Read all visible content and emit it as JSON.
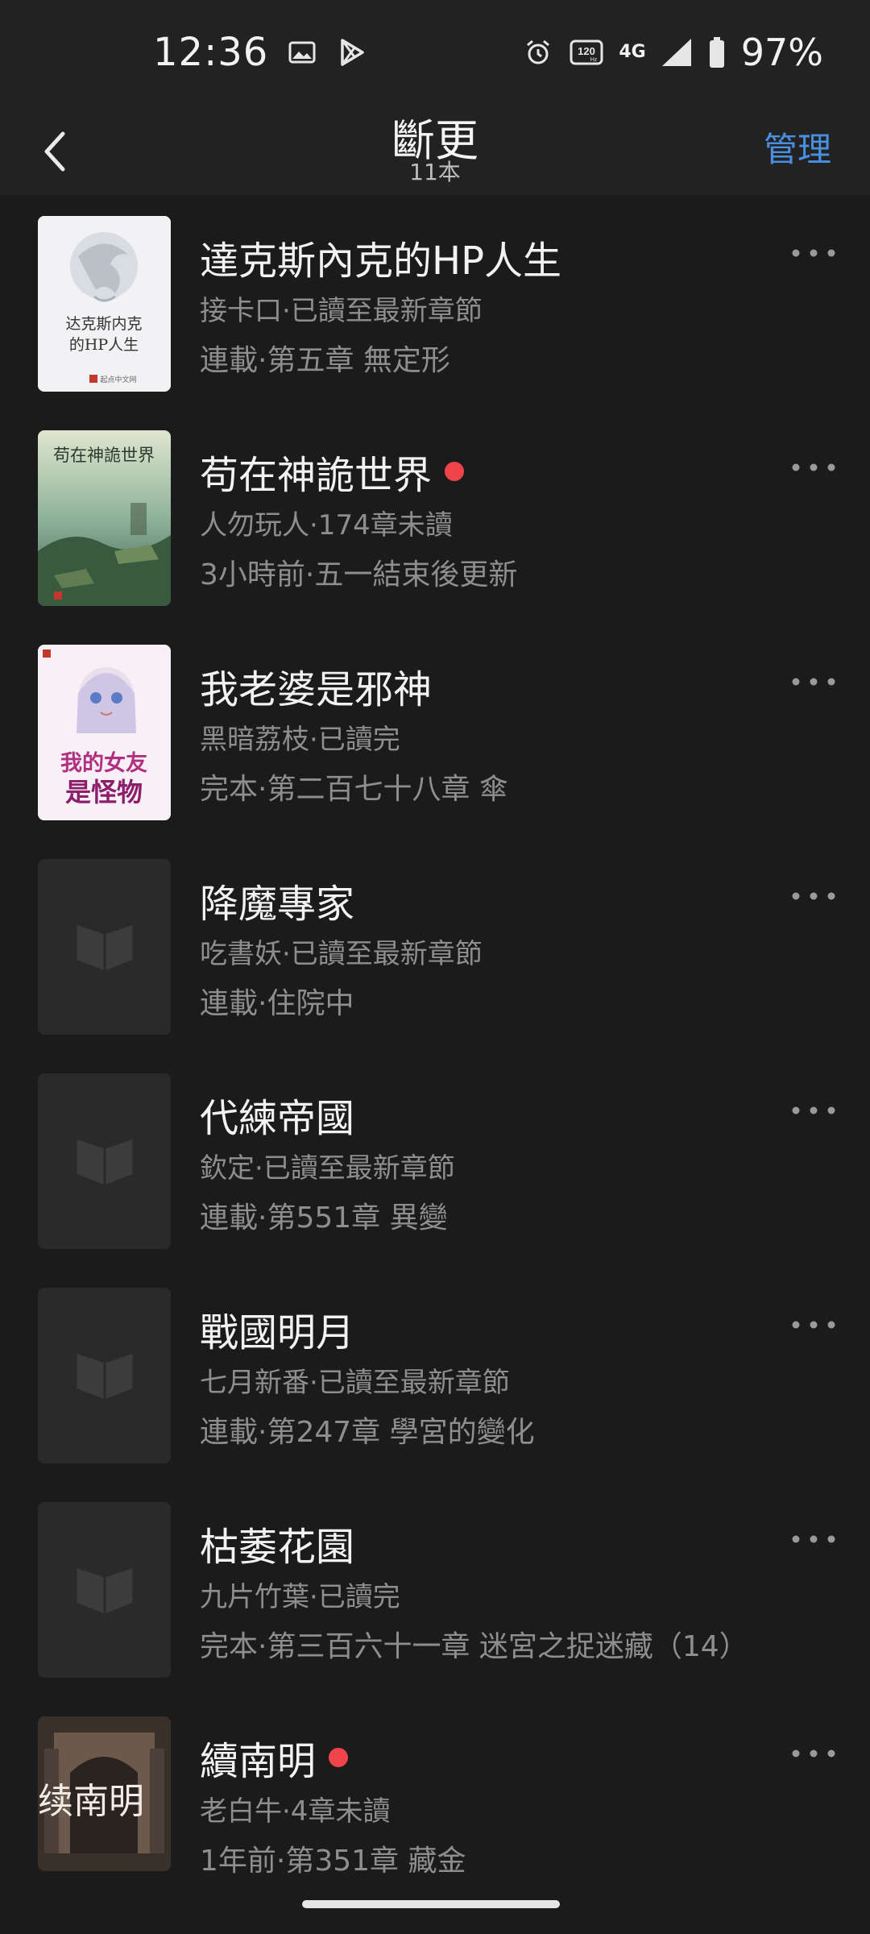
{
  "status_bar": {
    "time": "12:36",
    "network": "4G",
    "refresh_rate": "120",
    "battery": "97%"
  },
  "header": {
    "title": "斷更",
    "count": "11本",
    "manage_label": "管理"
  },
  "books": [
    {
      "title": "達克斯內克的HP人生",
      "author_status": "接卡口·已讀至最新章節",
      "latest": "連載·第五章 無定形",
      "unread_dot": false,
      "cover": "dragon"
    },
    {
      "title": "苟在神詭世界",
      "author_status": "人勿玩人·174章未讀",
      "latest": "3小時前·五一結束後更新",
      "unread_dot": true,
      "cover": "landscape"
    },
    {
      "title": "我老婆是邪神",
      "author_status": "黑暗荔枝·已讀完",
      "latest": "完本·第二百七十八章 傘",
      "unread_dot": false,
      "cover": "anime"
    },
    {
      "title": "降魔專家",
      "author_status": "吃書妖·已讀至最新章節",
      "latest": "連載·住院中",
      "unread_dot": false,
      "cover": "placeholder"
    },
    {
      "title": "代練帝國",
      "author_status": "欽定·已讀至最新章節",
      "latest": "連載·第551章 異變",
      "unread_dot": false,
      "cover": "placeholder"
    },
    {
      "title": "戰國明月",
      "author_status": "七月新番·已讀至最新章節",
      "latest": "連載·第247章 學宮的變化",
      "unread_dot": false,
      "cover": "placeholder"
    },
    {
      "title": "枯萎花園",
      "author_status": "九片竹葉·已讀完",
      "latest": "完本·第三百六十一章 迷宮之捉迷藏（14）",
      "unread_dot": false,
      "cover": "placeholder"
    },
    {
      "title": "續南明",
      "author_status": "老白牛·4章未讀",
      "latest": "1年前·第351章 藏金",
      "unread_dot": true,
      "cover": "gate"
    }
  ],
  "covers": {
    "dragon": {
      "line1": "达克斯内克",
      "line2": "的HP人生",
      "publisher": "起点中文网"
    },
    "landscape": {
      "title": "苟在神詭世界"
    },
    "anime": {
      "line1": "我的女友",
      "line2": "是怪物"
    },
    "gate": {
      "title": "续南明"
    }
  },
  "colors": {
    "accent": "#4a90e2",
    "unread_dot": "#f0444b",
    "background": "#1b1b1b",
    "header_bg": "#222222"
  }
}
